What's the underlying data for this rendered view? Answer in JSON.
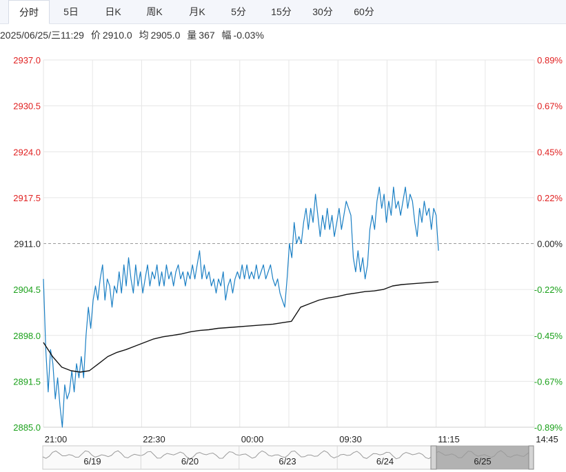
{
  "tabs": [
    {
      "label": "分时",
      "active": true
    },
    {
      "label": "5日"
    },
    {
      "label": "日K"
    },
    {
      "label": "周K"
    },
    {
      "label": "月K"
    },
    {
      "label": "5分"
    },
    {
      "label": "15分"
    },
    {
      "label": "30分"
    },
    {
      "label": "60分"
    }
  ],
  "info": {
    "datetime": "2025/06/25/三11:29",
    "price_label": "价",
    "price": "2910.0",
    "avg_label": "均",
    "avg": "2905.0",
    "volume_label": "量",
    "volume": "367",
    "change_label": "幅",
    "change": "-0.03%"
  },
  "colors": {
    "up": "#e02020",
    "down": "#1aa01a",
    "price_line": "#1a7fc4",
    "avg_line": "#111111",
    "grid": "#e6e6e6",
    "ref_line": "#999999"
  },
  "navigator": {
    "labels": [
      "6/19",
      "6/20",
      "6/23",
      "6/24",
      "6/25"
    ],
    "selected": "6/25"
  },
  "chart_data": {
    "type": "line",
    "reference_price": 2911.0,
    "ylim": [
      2885.0,
      2937.0
    ],
    "y_ticks": [
      "2937.0",
      "2930.5",
      "2924.0",
      "2917.5",
      "2911.0",
      "2904.5",
      "2898.0",
      "2891.5",
      "2885.0"
    ],
    "pct_ticks": [
      "0.89%",
      "0.67%",
      "0.45%",
      "0.22%",
      "0.00%",
      "-0.22%",
      "-0.45%",
      "-0.67%",
      "-0.89%"
    ],
    "x_ticks": [
      "21:00",
      "22:30",
      "00:00",
      "09:30",
      "11:15",
      "14:45"
    ],
    "series": [
      {
        "name": "价",
        "values": [
          2906,
          2896,
          2890,
          2896,
          2894,
          2889,
          2892,
          2888,
          2885,
          2891,
          2889,
          2890,
          2893,
          2890,
          2894,
          2892,
          2895,
          2892,
          2898,
          2902,
          2899,
          2903,
          2905,
          2903,
          2906,
          2908,
          2903,
          2906,
          2905,
          2902,
          2905,
          2904,
          2907,
          2904,
          2908,
          2905,
          2909,
          2906,
          2904,
          2908,
          2905,
          2907,
          2904,
          2906,
          2908,
          2905,
          2907,
          2906,
          2908,
          2905,
          2907,
          2905,
          2908,
          2906,
          2907,
          2905,
          2907,
          2908,
          2906,
          2907,
          2905,
          2907,
          2906,
          2908,
          2906,
          2908,
          2910,
          2906,
          2908,
          2906,
          2907,
          2905,
          2906,
          2904,
          2906,
          2905,
          2907,
          2903,
          2905,
          2906,
          2904,
          2906,
          2907,
          2906,
          2908,
          2906,
          2908,
          2906,
          2907,
          2906,
          2908,
          2906,
          2907,
          2908,
          2906,
          2907,
          2908,
          2906,
          2905,
          2906,
          2904,
          2903,
          2902,
          2906,
          2911,
          2909,
          2914,
          2911,
          2912,
          2911,
          2914,
          2916,
          2913,
          2916,
          2914,
          2918,
          2915,
          2912,
          2915,
          2913,
          2916,
          2913,
          2915,
          2912,
          2914,
          2916,
          2913,
          2915,
          2917,
          2916,
          2915,
          2909,
          2907,
          2910,
          2907,
          2909,
          2906,
          2908,
          2913,
          2915,
          2913,
          2917,
          2919,
          2916,
          2918,
          2914,
          2917,
          2915,
          2919,
          2916,
          2917,
          2915,
          2917,
          2919,
          2916,
          2918,
          2917,
          2914,
          2912,
          2916,
          2914,
          2917,
          2915,
          2916,
          2913,
          2916,
          2915,
          2910
        ]
      },
      {
        "name": "均",
        "values": [
          2897,
          2895,
          2893.5,
          2893,
          2892.8,
          2893,
          2894,
          2895,
          2895.6,
          2896,
          2896.5,
          2897,
          2897.5,
          2897.8,
          2898,
          2898.2,
          2898.5,
          2898.7,
          2898.8,
          2899,
          2899.1,
          2899.2,
          2899.3,
          2899.4,
          2899.5,
          2899.6,
          2899.8,
          2900,
          2902,
          2902.5,
          2903,
          2903.3,
          2903.5,
          2903.8,
          2904,
          2904.2,
          2904.3,
          2904.5,
          2905,
          2905.2,
          2905.3,
          2905.4,
          2905.5,
          2905.6
        ]
      }
    ]
  }
}
